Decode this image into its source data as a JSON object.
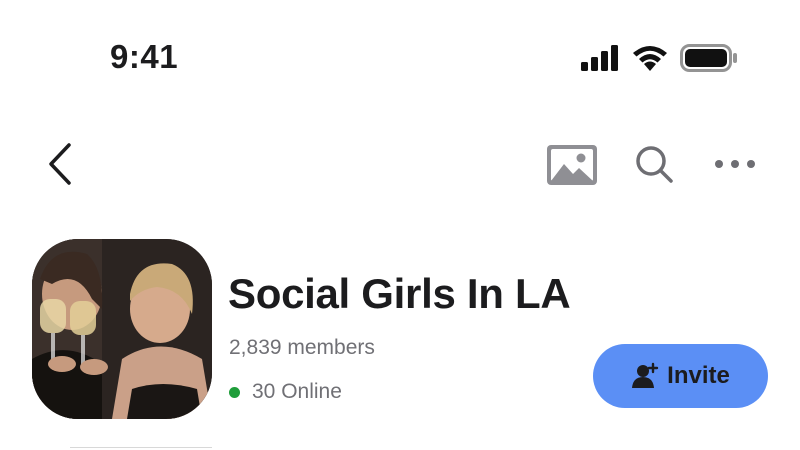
{
  "status_bar": {
    "time": "9:41",
    "icons": [
      "cellular-signal-icon",
      "wifi-icon",
      "battery-icon"
    ]
  },
  "nav_bar": {
    "icons": [
      "chevron-left-icon",
      "image-icon",
      "search-icon",
      "more-horizontal-icon"
    ]
  },
  "group": {
    "name": "Social Girls In LA",
    "members": "2,839 members",
    "online": "30 Online",
    "invite_label": "Invite",
    "invite_icon": "add-person-icon"
  },
  "colors": {
    "invite_button": "#5b8ff5",
    "online_dot": "#1f9d3a",
    "secondary_text": "#707075",
    "primary_text": "#1c1c1e"
  }
}
